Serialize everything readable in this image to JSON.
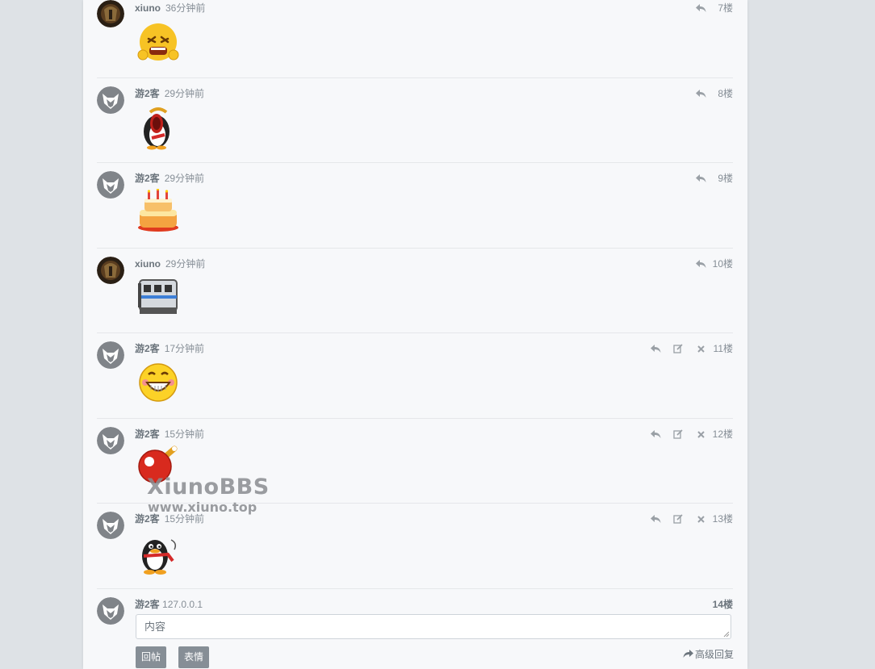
{
  "posts": [
    {
      "user": "xiuno",
      "time": "36分钟前",
      "floor": "7楼",
      "emoji": "angry-face",
      "avatar": "xiuno-avatar",
      "editable": false
    },
    {
      "user": "游2客",
      "time": "29分钟前",
      "floor": "8楼",
      "emoji": "yawning-penguin",
      "avatar": "guest-avatar",
      "editable": false
    },
    {
      "user": "游2客",
      "time": "29分钟前",
      "floor": "9楼",
      "emoji": "birthday-cake",
      "avatar": "guest-avatar",
      "editable": false
    },
    {
      "user": "xiuno",
      "time": "29分钟前",
      "floor": "10楼",
      "emoji": "train",
      "avatar": "xiuno-avatar",
      "editable": false
    },
    {
      "user": "游2客",
      "time": "17分钟前",
      "floor": "11楼",
      "emoji": "grinning-face",
      "avatar": "guest-avatar",
      "editable": true
    },
    {
      "user": "游2客",
      "time": "15分钟前",
      "floor": "12楼",
      "emoji": "ping-pong-paddle",
      "avatar": "guest-avatar",
      "editable": true
    },
    {
      "user": "游2客",
      "time": "15分钟前",
      "floor": "13楼",
      "emoji": "penguin",
      "avatar": "guest-avatar",
      "editable": true
    }
  ],
  "watermark": {
    "brand": "XiunoBBS",
    "url": "www.xiuno.top"
  },
  "reply": {
    "user": "游2客",
    "ip": "127.0.0.1",
    "floor": "14楼",
    "placeholder": "内容",
    "submit_label": "回帖",
    "emoji_label": "表情",
    "advanced_label": "高级回复"
  },
  "colors": {
    "page_bg": "#dee2e6",
    "card_bg": "#f7f8fa",
    "button_bg": "#868e96"
  }
}
